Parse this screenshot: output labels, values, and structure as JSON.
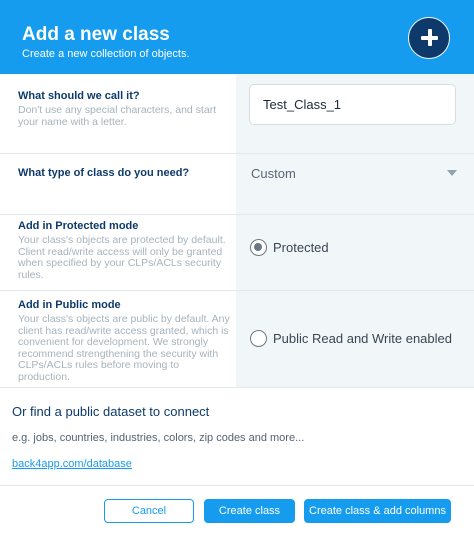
{
  "header": {
    "title": "Add a new class",
    "subtitle": "Create a new collection of objects.",
    "add_icon": "plus-icon"
  },
  "name_field": {
    "label": "What should we call it?",
    "description": "Don't use any special characters, and start your name with a letter.",
    "value": "Test_Class_1"
  },
  "type_field": {
    "label": "What type of class do you need?",
    "selected": "Custom",
    "arrow_icon": "chevron-down-icon"
  },
  "protected_mode": {
    "label": "Add in Protected mode",
    "description": "Your class's objects are protected by default. Client read/write access will only be granted when specified by your CLPs/ACLs security rules.",
    "option_label": "Protected",
    "selected": true
  },
  "public_mode": {
    "label": "Add in Public mode",
    "description": "Your class's objects are public by default. Any client has read/write access granted, which is convenient for development. We strongly recommend strengthening the security with CLPs/ACLs rules before moving to production.",
    "option_label": "Public Read and Write enabled",
    "selected": false
  },
  "dataset": {
    "title": "Or find a public dataset to connect",
    "hint": "e.g. jobs, countries, industries, colors, zip codes and more...",
    "link": "back4app.com/database"
  },
  "footer": {
    "cancel_label": "Cancel",
    "create_label": "Create class",
    "create_columns_label": "Create class & add columns"
  },
  "colors": {
    "header_bg": "#169cee",
    "add_button_bg": "#0e3a6b",
    "control_column_bg": "#f1f6f9",
    "label_title": "#0e3a6b",
    "label_desc": "#a6b3bd",
    "primary": "#169cee"
  }
}
